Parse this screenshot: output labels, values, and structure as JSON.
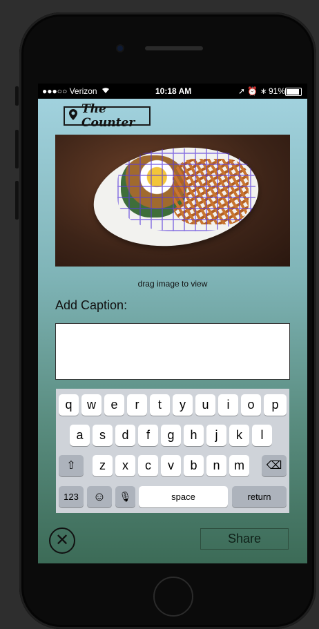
{
  "status_bar": {
    "carrier": "●●●○○ Verizon",
    "wifi_icon": "wifi-icon",
    "time": "10:18 AM",
    "indicators": "➚ ⏰ ∗",
    "battery_percent": "91%"
  },
  "header": {
    "location_icon": "map-pin-icon",
    "restaurant_name": "The Counter"
  },
  "photo": {
    "hint": "drag image to view"
  },
  "caption": {
    "label": "Add Caption:",
    "value": ""
  },
  "keyboard": {
    "row1": [
      "q",
      "w",
      "e",
      "r",
      "t",
      "y",
      "u",
      "i",
      "o",
      "p"
    ],
    "row2": [
      "a",
      "s",
      "d",
      "f",
      "g",
      "h",
      "j",
      "k",
      "l"
    ],
    "row3": [
      "z",
      "x",
      "c",
      "v",
      "b",
      "n",
      "m"
    ],
    "shift_symbol": "⇧",
    "delete_symbol": "⌫",
    "numbers_label": "123",
    "emoji_symbol": "☺",
    "mic_symbol": "🎙",
    "space_label": "space",
    "return_label": "return"
  },
  "actions": {
    "close_symbol": "✕",
    "share_label": "Share"
  }
}
